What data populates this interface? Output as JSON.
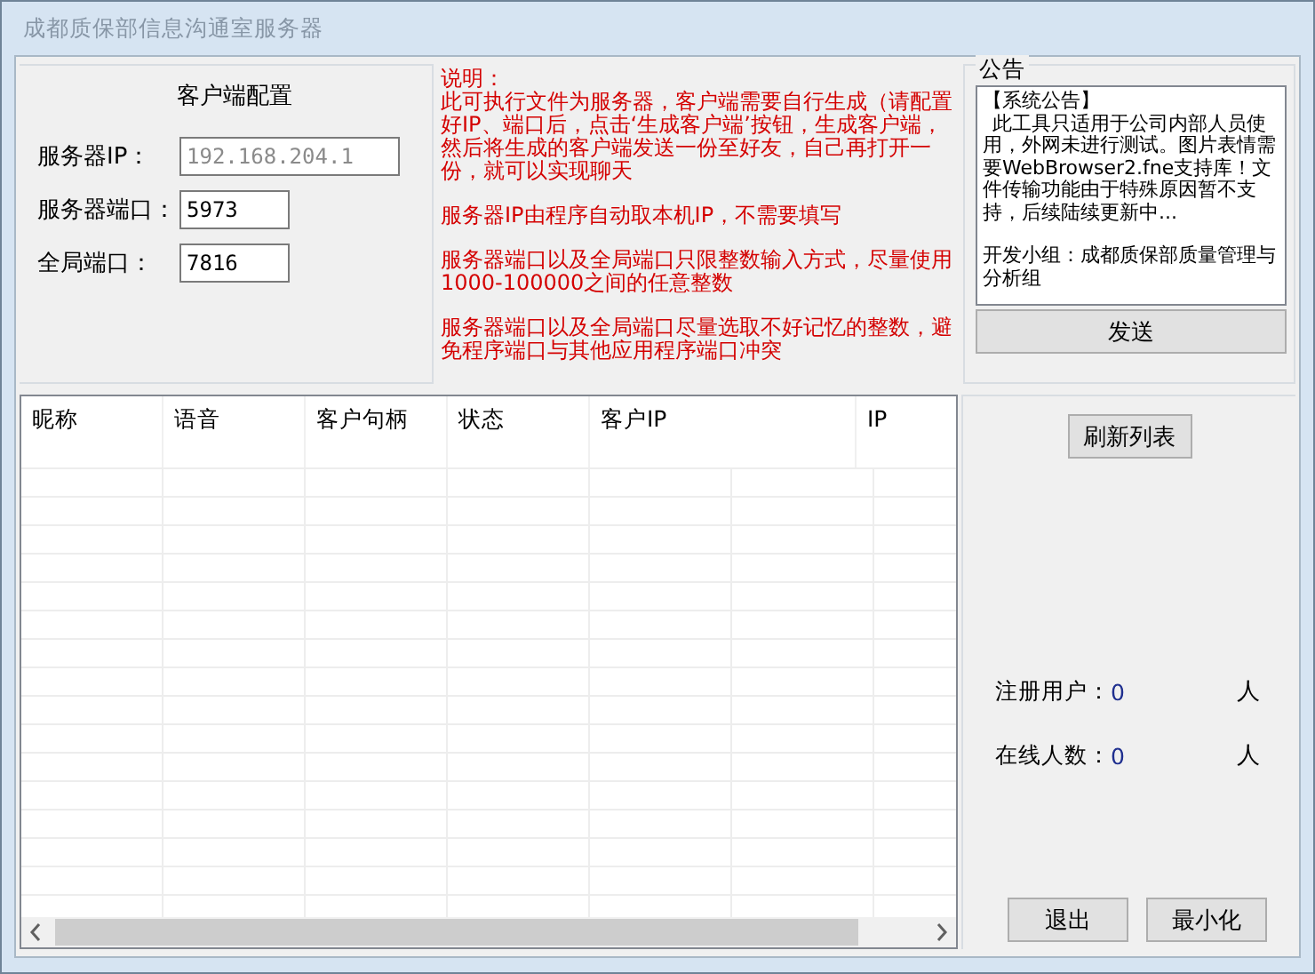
{
  "window": {
    "title": "成都质保部信息沟通室服务器"
  },
  "client_config": {
    "title": "客户端配置",
    "fields": [
      {
        "label": "服务器IP：",
        "value": "192.168.204.1",
        "disabled": true
      },
      {
        "label": "服务器端口：",
        "value": "5973",
        "disabled": false
      },
      {
        "label": "全局端口：",
        "value": "7816",
        "disabled": false
      }
    ]
  },
  "notes": {
    "heading": "说明：",
    "paragraphs": [
      "此可执行文件为服务器，客户端需要自行生成（请配置好IP、端口后，点击‘生成客户端’按钮，生成客户端，然后将生成的客户端发送一份至好友，自己再打开一份，就可以实现聊天",
      "服务器IP由程序自动取本机IP，不需要填写",
      "服务器端口以及全局端口只限整数输入方式，尽量使用1000-100000之间的任意整数",
      "服务器端口以及全局端口尽量选取不好记忆的整数，避免程序端口与其他应用程序端口冲突"
    ]
  },
  "announcement": {
    "title": "公告",
    "header": "【系统公告】",
    "body": "此工具只适用于公司内部人员使用，外网未进行测试。图片表情需要WebBrowser2.fne支持库！文件传输功能由于特殊原因暂不支持，后续陆续更新中...",
    "footer": "开发小组：成都质保部质量管理与分析组",
    "send_button": "发送"
  },
  "table": {
    "columns": [
      "昵称",
      "语音",
      "客户句柄",
      "状态",
      "客户IP",
      "IP"
    ]
  },
  "refresh_button": "刷新列表",
  "stats": [
    {
      "label": "注册用户：",
      "value": "0",
      "unit": "人"
    },
    {
      "label": "在线人数：",
      "value": "0",
      "unit": "人"
    }
  ],
  "buttons": [
    "退出",
    "最小化"
  ]
}
